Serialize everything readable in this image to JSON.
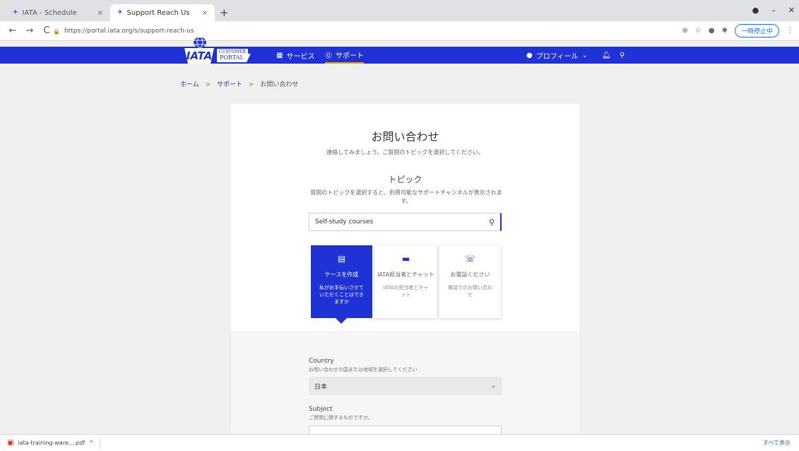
{
  "browser": {
    "tabs": [
      {
        "title": "IATA - Schedule",
        "active": false
      },
      {
        "title": "Support Reach Us",
        "active": true
      }
    ],
    "new_tab": "+",
    "url": "https://portal.iata.org/s/support-reach-us",
    "pause_label": "一時停止中",
    "controls": {
      "back": "←",
      "forward": "→",
      "reload": "C",
      "close": "×"
    }
  },
  "portal": {
    "logo": {
      "iata": "IATA",
      "customer": "CUSTOMER",
      "portal": "PORTAL"
    },
    "nav": {
      "services": "サービス",
      "support": "サポート"
    },
    "profile": "プロフィール",
    "colors": {
      "brand": "#1e32d6",
      "accent": "#f0a000"
    }
  },
  "breadcrumb": {
    "home": "ホーム",
    "support": "サポート",
    "current": "お問い合わせ",
    "sep": ">"
  },
  "main": {
    "title": "お問い合わせ",
    "subtitle": "連絡してみましょう。ご質問のトピックを選択してください。",
    "topic_heading": "トピック",
    "topic_desc": "質問のトピックを選択すると、利用可能なサポートチャンネルが表示されます。",
    "search_value": "Self-study courses",
    "options": [
      {
        "icon": "form-icon",
        "title": "ケースを作成",
        "desc": "私がお手伝いさせていただくことはできますか",
        "selected": true
      },
      {
        "icon": "chat-icon",
        "title": "IATA担当者とチャット",
        "desc": "IATAの担当者とチャット",
        "selected": false
      },
      {
        "icon": "phone-icon",
        "title": "お電話ください",
        "desc": "電話でのお問い合わせ",
        "selected": false
      }
    ],
    "country_label": "Country",
    "country_help": "お問い合わせの国または地域を選択してください",
    "country_value": "日本",
    "subject_label": "Subject",
    "subject_help": "ご質問に関するものですか。"
  },
  "downloads": {
    "file": "iata-training-ware....pdf",
    "show_all": "すべて表示",
    "caret": "^"
  }
}
